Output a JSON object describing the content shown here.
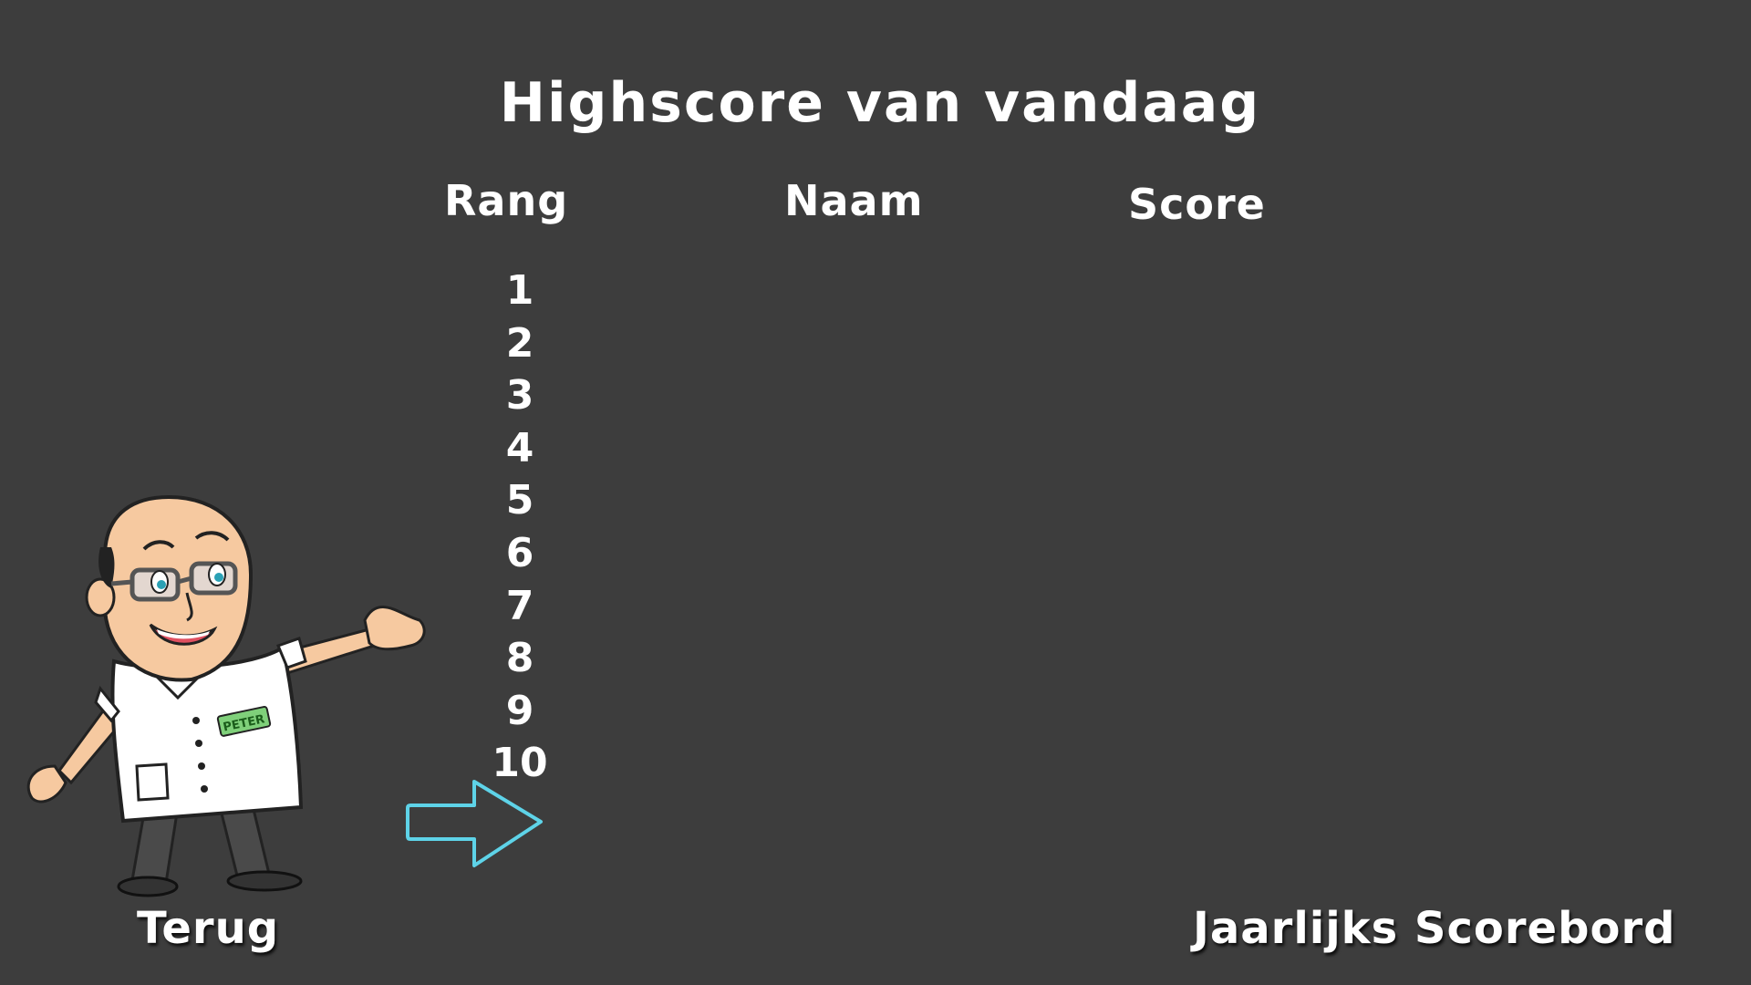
{
  "screen": {
    "title": "Highscore van vandaag"
  },
  "table": {
    "headers": {
      "rank": "Rang",
      "name": "Naam",
      "score": "Score"
    },
    "ranks": [
      "1",
      "2",
      "3",
      "4",
      "5",
      "6",
      "7",
      "8",
      "9",
      "10"
    ]
  },
  "navigation": {
    "back_label": "Terug",
    "yearly_label": "Jaarlijks Scorebord",
    "next_icon": "arrow-right-icon"
  },
  "mascot": {
    "badge_text": "PETER"
  },
  "colors": {
    "background": "#3d3d3d",
    "text": "#ffffff",
    "arrow_outline": "#5ed3e8"
  }
}
